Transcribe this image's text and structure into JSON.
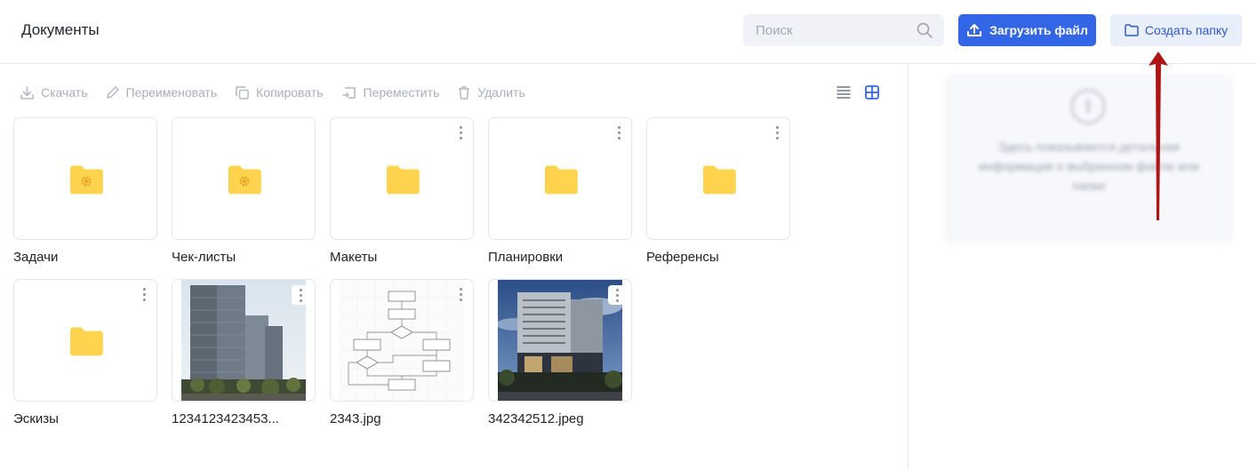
{
  "header": {
    "title": "Документы",
    "search_placeholder": "Поиск",
    "upload_label": "Загрузить файл",
    "create_folder_label": "Создать папку"
  },
  "toolbar": {
    "download": "Скачать",
    "rename": "Переименовать",
    "copy": "Копировать",
    "move": "Переместить",
    "delete": "Удалить"
  },
  "info_panel": {
    "text": "Здесь показывается детальная информация о выбранном файле или папке"
  },
  "items": [
    {
      "name": "Задачи",
      "type": "system-folder"
    },
    {
      "name": "Чек-листы",
      "type": "system-folder"
    },
    {
      "name": "Макеты",
      "type": "folder"
    },
    {
      "name": "Планировки",
      "type": "folder"
    },
    {
      "name": "Референсы",
      "type": "folder"
    },
    {
      "name": "Эскизы",
      "type": "folder"
    },
    {
      "name": "1234123423453...",
      "type": "image"
    },
    {
      "name": "2343.jpg",
      "type": "image"
    },
    {
      "name": "342342512.jpeg",
      "type": "image"
    }
  ],
  "colors": {
    "accent": "#3366e6",
    "folder": "#ffd34e",
    "annotation_arrow": "#b01515"
  }
}
